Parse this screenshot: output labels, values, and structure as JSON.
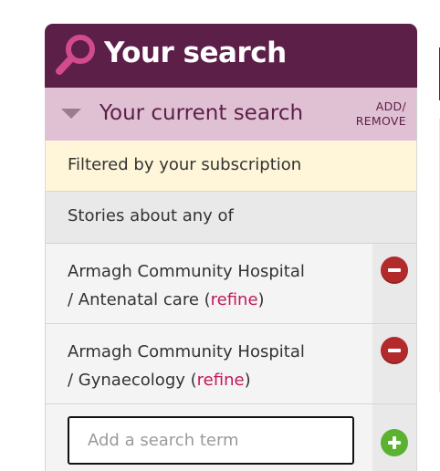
{
  "header": {
    "title": "Your search",
    "icon": "magnifier-icon",
    "color": "#5c1f48"
  },
  "current_search": {
    "label": "Your current search",
    "add_remove_line1": "ADD/",
    "add_remove_line2": "REMOVE"
  },
  "filter_notice": "Filtered by your subscription",
  "stories_label": "Stories about any of",
  "terms": [
    {
      "line1": "Armagh Community Hospital",
      "line2_prefix": "/ Antenatal care (",
      "refine": "refine",
      "suffix": ")"
    },
    {
      "line1": "Armagh Community Hospital",
      "line2_prefix": "/ Gynaecology (",
      "refine": "refine",
      "suffix": ")"
    }
  ],
  "search_input": {
    "placeholder": "Add a search term",
    "value": ""
  },
  "colors": {
    "remove": "#b32a2a",
    "add": "#5bb130",
    "refine_link": "#c2185b"
  }
}
